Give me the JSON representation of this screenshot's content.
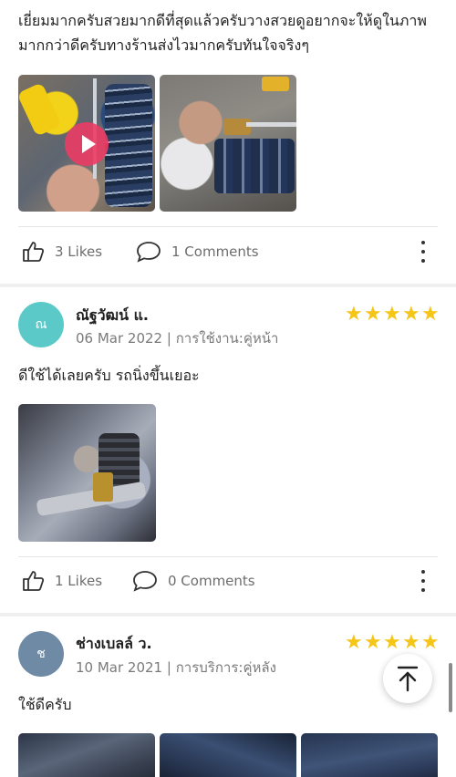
{
  "review1": {
    "text": "เยี่ยมมากครับสวยมากดีที่สุดแล้วครับวางสวยดูอยากจะให้ดูในภาพมากกว่าดีครับทางร้านส่งไวมากครับทันใจจริงๆ",
    "likes": "3 Likes",
    "comments": "1 Comments"
  },
  "review2": {
    "avatar_initial": "ณ",
    "avatar_color": "#5cc9c9",
    "author": "ณัฐวัฒน์ แ.",
    "date": "06 Mar 2022",
    "usage": "การใช้งาน:คู่หน้า",
    "rating": 5,
    "text": "ดีใช้ได้เลยครับ รถนิ่งขึ้นเยอะ",
    "likes": "1 Likes",
    "comments": "0 Comments"
  },
  "review3": {
    "avatar_initial": "ช",
    "avatar_color": "#6e8aa4",
    "author": "ช่างเบลล์ ว.",
    "date": "10 Mar 2021",
    "usage": "การบริการ:คู่หลัง",
    "rating": 5,
    "text": "ใช้ดีครับ"
  },
  "colors": {
    "star": "#f5c518",
    "play_button": "#eb3c64",
    "muted_text": "#7a7a7a"
  },
  "icons": {
    "like": "thumbs-up-icon",
    "comment": "speech-bubble-icon",
    "more": "vertical-dots-icon",
    "scroll_top": "arrow-up-to-top-icon",
    "play": "play-icon"
  }
}
